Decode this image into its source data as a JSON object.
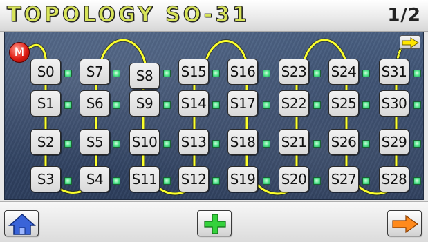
{
  "header": {
    "title": "TOPOLOGY SO-31",
    "page_indicator": "1/2"
  },
  "panel": {
    "master_label": "M",
    "slots": [
      [
        "S0",
        "S7",
        "S8",
        "S15",
        "S16",
        "S23",
        "S24",
        "S31"
      ],
      [
        "S1",
        "S6",
        "S9",
        "S14",
        "S17",
        "S22",
        "S25",
        "S30"
      ],
      [
        "S2",
        "S5",
        "S10",
        "S13",
        "S18",
        "S21",
        "S26",
        "S29"
      ],
      [
        "S3",
        "S4",
        "S11",
        "S12",
        "S19",
        "S20",
        "S27",
        "S28"
      ]
    ],
    "next_page_icon": "arrow-right-icon"
  },
  "footer": {
    "home_icon": "home-icon",
    "add_icon": "plus-icon",
    "next_icon": "arrow-right-icon"
  },
  "colors": {
    "title_fill": "#d8e45a",
    "wire": "#ffff33",
    "led": "#4fe38a",
    "master": "#e01c14",
    "panel": "#3a4d70"
  }
}
